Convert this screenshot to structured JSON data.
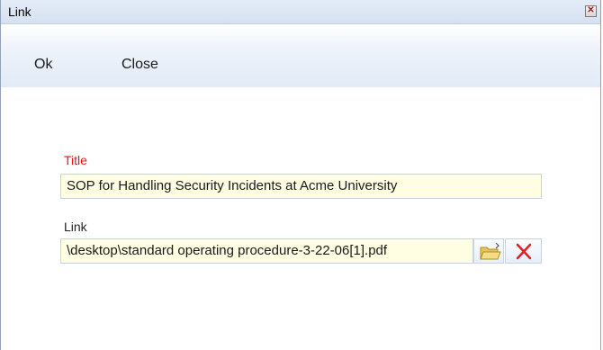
{
  "window": {
    "title": "Link",
    "close_glyph": "✕"
  },
  "menu": {
    "ok_label": "Ok",
    "close_label": "Close"
  },
  "form": {
    "title_label": "Title",
    "title_value": "SOP for Handling Security Incidents at Acme University",
    "link_label": "Link",
    "link_value": "\\desktop\\standard operating procedure-3-22-06[1].pdf"
  },
  "icons": {
    "browse": "folder-open-icon",
    "clear": "red-x-icon"
  },
  "colors": {
    "title_label": "#e8161c",
    "input_background": "#fffee3",
    "clear_icon": "#e02020",
    "folder_icon": "#f3d06a"
  }
}
